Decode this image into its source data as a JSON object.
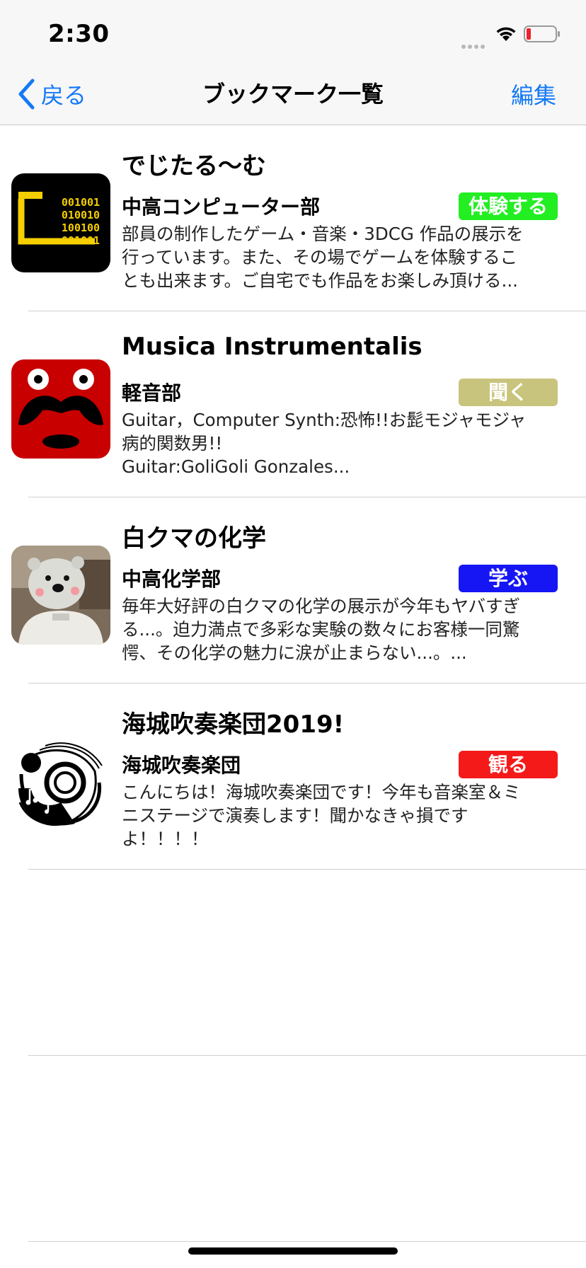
{
  "status_bar": {
    "time": "2:30",
    "icons": [
      "signal-dots-icon",
      "wifi-icon",
      "battery-low-icon"
    ]
  },
  "nav": {
    "back_label": "戻る",
    "title": "ブックマーク一覧",
    "edit_label": "編集",
    "accent_color": "#1479f6"
  },
  "bookmarks": [
    {
      "title": "でじたる〜む",
      "club": "中高コンピューター部",
      "badge": "体験する",
      "badge_color": "#22ee22",
      "desc_lines": [
        "部員の制作したゲーム・音楽・3DCG 作品の展示を",
        "行っています。また、その場でゲームを体験するこ",
        "とも出来ます。ご自宅でも作品をお楽しみ頂ける..."
      ],
      "thumbnail": "computer-club-logo",
      "thumb_text": [
        "001001",
        "010010",
        "100100",
        "001001"
      ]
    },
    {
      "title": "Musica Instrumentalis",
      "club": "軽音部",
      "badge": "聞く",
      "badge_color": "#c9c47d",
      "desc_lines": [
        "Guitar，Computer Synth:恐怖!!お髭モジャモジャ",
        "病的関数男!!",
        "Guitar:GoliGoli Gonzales..."
      ],
      "thumbnail": "red-mustache-face"
    },
    {
      "title": "白クマの化学",
      "club": "中高化学部",
      "badge": "学ぶ",
      "badge_color": "#1616f5",
      "desc_lines": [
        "毎年大好評の白クマの化学の展示が今年もヤバすぎ",
        "る...。迫力満点で多彩な実験の数々にお客様一同驚",
        "愕、その化学の魅力に涙が止まらない...。..."
      ],
      "thumbnail": "polar-bear-costume-photo"
    },
    {
      "title": "海城吹奏楽団2019!",
      "club": "海城吹奏楽団",
      "badge": "観る",
      "badge_color": "#f41a1a",
      "desc_lines": [
        "こんにちは！海城吹奏楽団です！今年も音楽室＆ミ",
        "ニステージで演奏します！聞かなきゃ損です",
        "よ！！！！"
      ],
      "thumbnail": "brass-band-horn-logo"
    }
  ]
}
